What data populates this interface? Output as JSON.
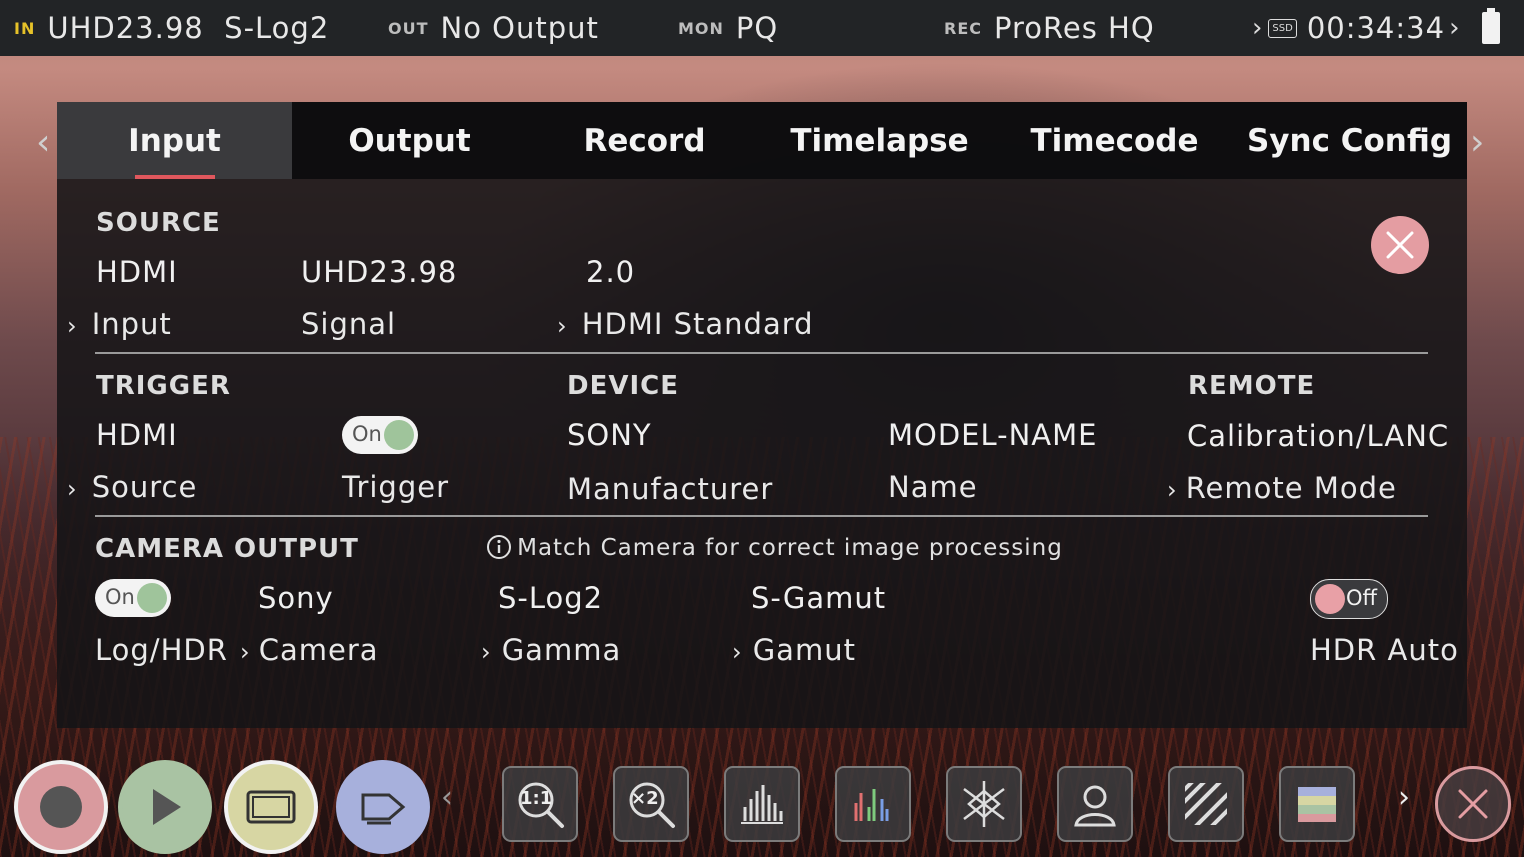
{
  "status_bar": {
    "in_tag": "IN",
    "in_value": "UHD23.98  S-Log2",
    "out_tag": "OUT",
    "out_value": "No Output",
    "mon_tag": "MON",
    "mon_value": "PQ",
    "rec_tag": "REC",
    "rec_value": "ProRes HQ",
    "media_label": "SSD",
    "time": "00:34:34"
  },
  "tabs": [
    "Input",
    "Output",
    "Record",
    "Timelapse",
    "Timecode",
    "Sync Config"
  ],
  "active_tab": "Input",
  "source": {
    "heading": "SOURCE",
    "input_value": "HDMI",
    "input_label": "Input",
    "signal_value": "UHD23.98",
    "signal_label": "Signal",
    "standard_value": "2.0",
    "standard_label": "HDMI Standard"
  },
  "trigger": {
    "heading": "TRIGGER",
    "source_value": "HDMI",
    "source_label": "Source",
    "toggle_text": "On",
    "toggle_label": "Trigger"
  },
  "device": {
    "heading": "DEVICE",
    "manufacturer_value": "SONY",
    "manufacturer_label": "Manufacturer",
    "name_value": "MODEL-NAME",
    "name_label": "Name"
  },
  "remote": {
    "heading": "REMOTE",
    "mode_value": "Calibration/LANC",
    "mode_label": "Remote Mode"
  },
  "camera_output": {
    "heading": "CAMERA OUTPUT",
    "info_note": "Match Camera for correct image processing",
    "log_toggle_text": "On",
    "log_label": "Log/HDR",
    "camera_value": "Sony",
    "camera_label": "Camera",
    "gamma_value": "S-Log2",
    "gamma_label": "Gamma",
    "gamut_value": "S-Gamut",
    "gamut_label": "Gamut",
    "hdr_toggle_text": "Off",
    "hdr_label": "HDR Auto"
  },
  "bottom_tools": {
    "zoom_1to1_text": "1:1",
    "zoom_x2_text": "×2"
  },
  "colors": {
    "accent_red": "#e0575d",
    "record_button": "#d99a9e",
    "play_button": "#a9c3a3",
    "display_button": "#d7d6a3",
    "tag_button": "#a7b0dc",
    "in_tag": "#e6c229"
  }
}
